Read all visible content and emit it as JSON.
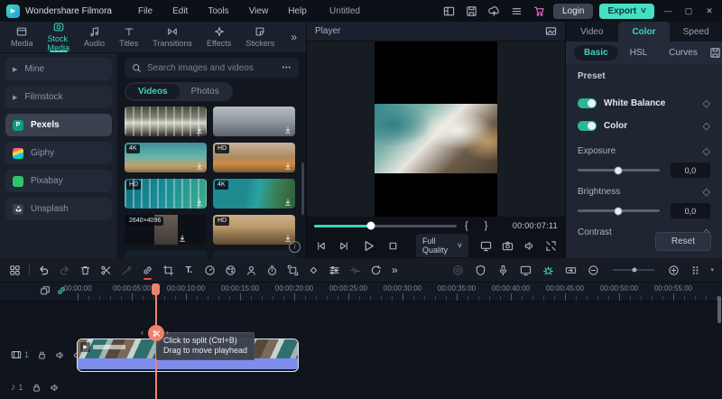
{
  "titlebar": {
    "app_name": "Wondershare Filmora",
    "menus": [
      "File",
      "Edit",
      "Tools",
      "View",
      "Help"
    ],
    "project_title": "Untitled",
    "login_label": "Login",
    "export_label": "Export"
  },
  "icons": {
    "more_tabs": "»",
    "ellipsis": "•••",
    "caret_down": "˅",
    "caret_small": "▾",
    "diamond": "◇",
    "music_note": "♪",
    "info": "i",
    "mark_in": "{",
    "mark_out": "}",
    "minimize": "—",
    "maximize": "▢",
    "close": "✕",
    "text_tool": "T.",
    "triangle": "▶",
    "arrow_left": "‹",
    "arrow_right": "›"
  },
  "media_tabs": [
    {
      "label": "Media"
    },
    {
      "label": "Stock Media"
    },
    {
      "label": "Audio"
    },
    {
      "label": "Titles"
    },
    {
      "label": "Transitions"
    },
    {
      "label": "Effects"
    },
    {
      "label": "Stickers"
    }
  ],
  "stock": {
    "sidebar": [
      {
        "label": "Mine"
      },
      {
        "label": "Filmstock"
      },
      {
        "label": "Pexels"
      },
      {
        "label": "Giphy"
      },
      {
        "label": "Pixabay"
      },
      {
        "label": "Unsplash"
      }
    ],
    "search_placeholder": "Search images and videos",
    "filter_videos": "Videos",
    "filter_photos": "Photos",
    "thumbs": [
      {
        "badge": ""
      },
      {
        "badge": ""
      },
      {
        "badge": "4K"
      },
      {
        "badge": "HD"
      },
      {
        "badge": "HD"
      },
      {
        "badge": "4K"
      },
      {
        "badge": "2640×4096"
      },
      {
        "badge": "HD"
      },
      {
        "badge": ""
      },
      {
        "badge": ""
      }
    ]
  },
  "player": {
    "title": "Player",
    "timecode": "00:00:07:11",
    "quality_label": "Full Quality"
  },
  "color_panel": {
    "tabs": [
      {
        "label": "Video"
      },
      {
        "label": "Color"
      },
      {
        "label": "Speed"
      }
    ],
    "subtabs": [
      {
        "label": "Basic"
      },
      {
        "label": "HSL"
      },
      {
        "label": "Curves"
      }
    ],
    "preset_label": "Preset",
    "toggle_white_balance": "White Balance",
    "toggle_color": "Color",
    "exposure_label": "Exposure",
    "exposure_value": "0,0",
    "brightness_label": "Brightness",
    "brightness_value": "0,0",
    "contrast_label": "Contrast",
    "reset_label": "Reset"
  },
  "timeline": {
    "ruler_labels": [
      "00:00:00",
      "00:00:05:00",
      "00:00:10:00",
      "00:00:15:00",
      "00:00:20:00",
      "00:00:25:00",
      "00:00:30:00",
      "00:00:35:00",
      "00:00:40:00",
      "00:00:45:00",
      "00:00:50:00",
      "00:00:55:00"
    ],
    "tooltip_line1": "Click to split (Ctrl+B)",
    "tooltip_line2": "Drag to move playhead",
    "video_track_number": "1",
    "audio_track_number": "1"
  },
  "colors": {
    "accent": "#3fd3be",
    "playhead": "#f0826d",
    "clip_audio_bar": "#7e8ced",
    "export_button": "#45dfc5",
    "cart": "#e36bb4"
  }
}
